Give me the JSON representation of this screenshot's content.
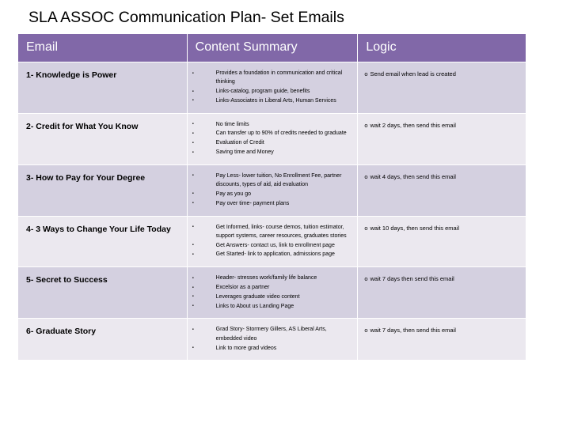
{
  "slide": {
    "title": "SLA ASSOC Communication Plan- Set Emails"
  },
  "table": {
    "headers": {
      "email": "Email",
      "content_summary": "Content Summary",
      "logic": "Logic"
    },
    "colors": {
      "header_bg": "#8168a8",
      "header_text": "#ffffff",
      "row_dark_bg": "#d4d0e0",
      "row_light_bg": "#ebe8ef",
      "text": "#000000"
    },
    "logic_marker": "o",
    "rows": [
      {
        "email": "1- Knowledge is Power",
        "content": [
          "Provides a foundation in communication and critical thinking",
          "Links-catalog, program guide, benefits",
          "Links-Associates in Liberal Arts, Human Services"
        ],
        "logic": "Send email when lead is created"
      },
      {
        "email": "2- Credit for What You Know",
        "content": [
          "No time limits",
          "Can transfer up to 90% of credits needed to graduate",
          "Evaluation of Credit",
          "Saving time and Money"
        ],
        "logic": "wait 2 days, then send this email"
      },
      {
        "email": "3- How to Pay for Your Degree",
        "content": [
          "Pay Less- lower tuition, No Enrollment Fee, partner discounts, types of aid, aid evaluation",
          "Pay as you go",
          "Pay over time- payment plans"
        ],
        "logic": "wait 4 days, then send this email"
      },
      {
        "email": "4- 3 Ways to Change Your Life Today",
        "content": [
          "Get Informed, links- course demos, tuition estimator, support systems, career resources, graduates stories",
          "Get Answers- contact us, link to enrollment page",
          "Get Started- link to application, admissions page"
        ],
        "logic": "wait 10 days, then send this email"
      },
      {
        "email": "5- Secret to Success",
        "content": [
          "Header- stresses work/family life balance",
          "Excelsior as a partner",
          "Leverages graduate video content",
          "Links to About us Landing Page"
        ],
        "logic": "wait 7 days then send this email"
      },
      {
        "email": "6- Graduate Story",
        "content": [
          "Grad Story- Stormery Gillers, AS Liberal Arts, embedded video",
          "Link to more grad videos"
        ],
        "logic": "wait 7 days, then send this email"
      }
    ]
  }
}
